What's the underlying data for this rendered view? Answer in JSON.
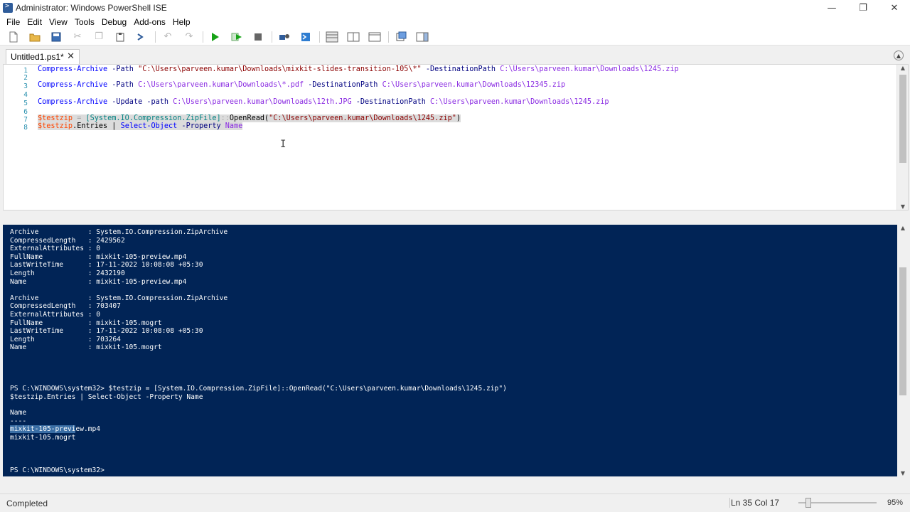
{
  "window": {
    "title": "Administrator: Windows PowerShell ISE",
    "controls": {
      "minimize": "—",
      "restore": "❐",
      "close": "✕"
    }
  },
  "menu": [
    "File",
    "Edit",
    "View",
    "Tools",
    "Debug",
    "Add-ons",
    "Help"
  ],
  "toolbar": {
    "icons": [
      "new-file-icon",
      "open-folder-icon",
      "save-icon",
      "cut-icon",
      "copy-icon",
      "paste-icon",
      "powershell-prompt-icon",
      "undo-icon",
      "redo-icon",
      "run-script-icon",
      "run-selection-icon",
      "stop-icon",
      "remote-powershell-icon",
      "powershell-console-icon",
      "layout-top-icon",
      "layout-right-icon",
      "layout-max-icon",
      "show-command-icon",
      "addon-pane-icon"
    ]
  },
  "tab": {
    "label": "Untitled1.ps1*",
    "close": "✕"
  },
  "script": {
    "line_numbers": [
      "1",
      "2",
      "3",
      "4",
      "5",
      "6",
      "7",
      "8"
    ],
    "lines": [
      {
        "n": "1",
        "cmd": "Compress-Archive",
        "p1": " -Path ",
        "s1": "\"C:\\Users\\parveen.kumar\\Downloads\\mixkit-slides-transition-105\\*\"",
        "p2": " -DestinationPath ",
        "s2": "C:\\Users\\parveen.kumar\\Downloads\\1245.zip"
      },
      {
        "n": "3",
        "cmd": "Compress-Archive",
        "p1": " -Path ",
        "s1": "C:\\Users\\parveen.kumar\\Downloads\\*.pdf",
        "p2": " -DestinationPath ",
        "s2": "C:\\Users\\parveen.kumar\\Downloads\\12345.zip"
      },
      {
        "n": "5",
        "cmd": "Compress-Archive",
        "p1": " -Update -path ",
        "s1": "C:\\Users\\parveen.kumar\\Downloads\\12th.JPG",
        "p2": " -DestinationPath ",
        "s2": "C:\\Users\\parveen.kumar\\Downloads\\1245.zip"
      }
    ],
    "line7": {
      "var": "$testzip",
      "eq": " = ",
      "type": "[System.IO.Compression.ZipFile]",
      "sep": "::",
      "method": "OpenRead",
      "open": "(",
      "str": "\"C:\\Users\\parveen.kumar\\Downloads\\1245.zip\"",
      "close": ")"
    },
    "line8": {
      "var": "$testzip",
      "member": ".Entries",
      "pipe": " | ",
      "cmd": "Select-Object",
      "param": " -Property ",
      "arg": "Name"
    }
  },
  "console": {
    "block1": "Archive            : System.IO.Compression.ZipArchive\nCompressedLength   : 2429562\nExternalAttributes : 0\nFullName           : mixkit-105-preview.mp4\nLastWriteTime      : 17-11-2022 10:08:08 +05:30\nLength             : 2432190\nName               : mixkit-105-preview.mp4\n\nArchive            : System.IO.Compression.ZipArchive\nCompressedLength   : 703407\nExternalAttributes : 0\nFullName           : mixkit-105.mogrt\nLastWriteTime      : 17-11-2022 10:08:08 +05:30\nLength             : 703264\nName               : mixkit-105.mogrt",
    "prompt_cmd": "PS C:\\WINDOWS\\system32> $testzip = [System.IO.Compression.ZipFile]::OpenRead(\"C:\\Users\\parveen.kumar\\Downloads\\1245.zip\")\n$testzip.Entries | Select-Object -Property Name",
    "header": "Name\n----",
    "row1_sel": "mixkit-105-previ",
    "row1_rest": "ew.mp4",
    "row2": "mixkit-105.mogrt",
    "final_prompt": "PS C:\\WINDOWS\\system32>"
  },
  "status": {
    "text": "Completed",
    "position": "Ln 35  Col 17",
    "zoom": "95%"
  }
}
